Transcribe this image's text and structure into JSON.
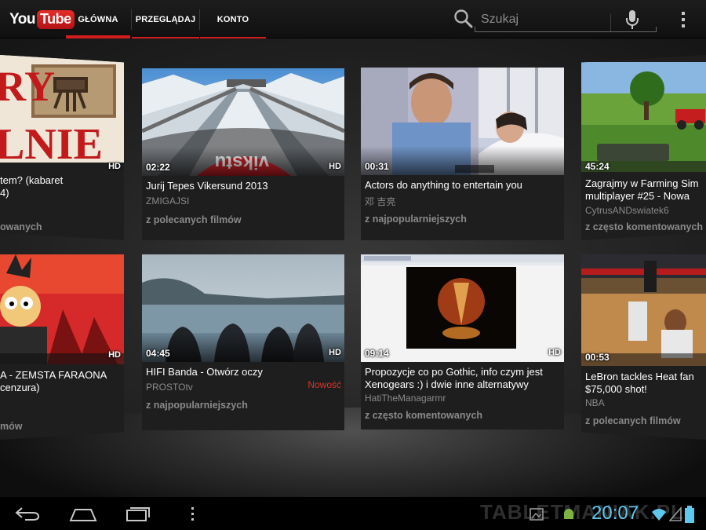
{
  "app": {
    "logo_you": "You",
    "logo_tube": "Tube"
  },
  "tabs": [
    {
      "label": "GŁÓWNA",
      "active": true
    },
    {
      "label": "PRZEGLĄDAJ",
      "active": false
    },
    {
      "label": "KONTO",
      "active": false
    }
  ],
  "search": {
    "placeholder": "Szukaj",
    "value": ""
  },
  "colors": {
    "accent": "#d21d1d",
    "new_badge": "#d8362d",
    "clock": "#5ec8ee"
  },
  "videos": {
    "row1": [
      {
        "title": "tem? (kabaret",
        "title2": "4)",
        "source": "owanych",
        "hd": "HD",
        "duration": ""
      },
      {
        "duration": "02:22",
        "hd": "HD",
        "title": "Jurij Tepes Vikersund 2013",
        "author": "ZMIGAJSI",
        "source": "z polecanych filmów"
      },
      {
        "duration": "00:31",
        "hd": "",
        "title": "Actors do anything to entertain you",
        "author": "邓 吉亮",
        "source": "z najpopularniejszych"
      },
      {
        "duration": "45:24",
        "hd": "",
        "title": "Zagrajmy w Farming Sim",
        "title2": "multiplayer #25 - Nowa",
        "author": "CytrusANDswiatek6",
        "source": "z często komentowanych"
      }
    ],
    "row2": [
      {
        "title": "A - ZEMSTA FARAONA",
        "title2": " cenzura)",
        "source": "mów",
        "hd": "HD",
        "duration": ""
      },
      {
        "duration": "04:45",
        "hd": "HD",
        "title": "HIFI Banda - Otwórz oczy",
        "author": "PROSTOtv",
        "badge": "Nowość",
        "source": "z najpopularniejszych"
      },
      {
        "duration": "09:14",
        "hd": "HD",
        "title": "Propozycje co po Gothic, info czym jest",
        "title2": "Xenogears :) i dwie inne alternatywy",
        "author": "HatiTheManagarmr",
        "source": "z często komentowanych"
      },
      {
        "duration": "00:53",
        "hd": "",
        "title": "LeBron tackles Heat fan",
        "title2": "$75,000 shot!",
        "author": "NBA",
        "source": "z polecanych filmów"
      }
    ]
  },
  "thumb_text": {
    "left_top_l1": "RY",
    "left_top_l2": "LNIE",
    "ski_banner": "vikstu"
  },
  "status": {
    "time": "20:07",
    "watermark": "TABLETMANIAK.PL"
  },
  "icons": {
    "search": "search-icon",
    "mic": "microphone-icon",
    "overflow": "overflow-menu-icon",
    "back": "back-icon",
    "home": "home-icon",
    "recents": "recent-apps-icon",
    "menu": "menu-icon",
    "wifi": "wifi-icon",
    "signal": "signal-icon",
    "battery": "battery-icon"
  }
}
